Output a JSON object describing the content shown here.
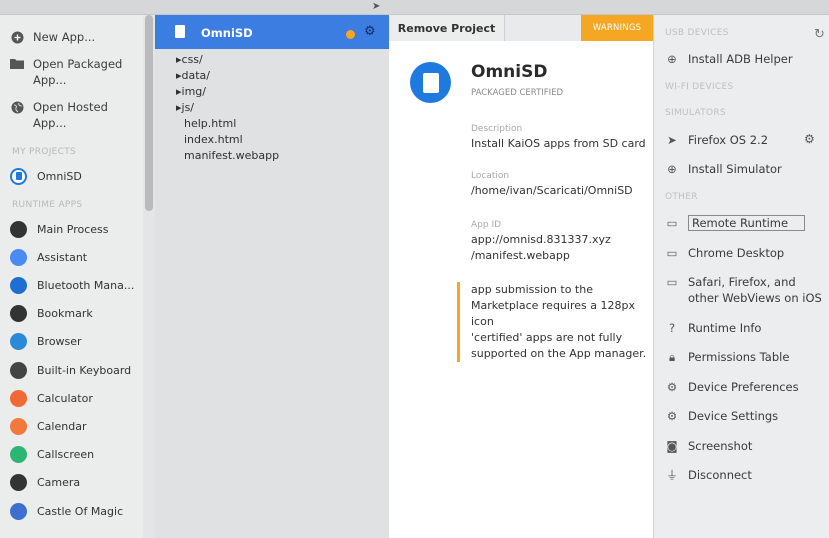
{
  "sidebar": {
    "new_app": "New App...",
    "open_packaged": "Open Packaged App...",
    "open_hosted": "Open Hosted App...",
    "my_projects_header": "MY PROJECTS",
    "project": "OmniSD",
    "runtime_apps_header": "RUNTIME APPS",
    "apps": [
      {
        "label": "Main Process",
        "color": "#333333"
      },
      {
        "label": "Assistant",
        "color": "#4a8af4"
      },
      {
        "label": "Bluetooth Mana...",
        "color": "#1f6fd1"
      },
      {
        "label": "Bookmark",
        "color": "#333333"
      },
      {
        "label": "Browser",
        "color": "#2a8ad8"
      },
      {
        "label": "Built-in Keyboard",
        "color": "#444444"
      },
      {
        "label": "Calculator",
        "color": "#f06a35"
      },
      {
        "label": "Calendar",
        "color": "#f2793d"
      },
      {
        "label": "Callscreen",
        "color": "#2bb673"
      },
      {
        "label": "Camera",
        "color": "#333333"
      },
      {
        "label": "Castle Of Magic",
        "color": "#3c6fd0"
      }
    ]
  },
  "files": {
    "project": "OmniSD",
    "tree": [
      "▸css/",
      "▸data/",
      "▸img/",
      "▸js/",
      "help.html",
      "index.html",
      "manifest.webapp"
    ]
  },
  "details": {
    "remove_label": "Remove Project",
    "warnings_label": "WARNINGS",
    "title": "OmniSD",
    "subtitle": "PACKAGED CERTIFIED",
    "description_label": "Description",
    "description": "Install KaiOS apps from SD card",
    "location_label": "Location",
    "location": "/home/ivan/Scaricati/OmniSD",
    "appid_label": "App ID",
    "appid_line1": "app://omnisd.831337.xyz",
    "appid_line2": "/manifest.webapp",
    "warning_1": "app submission to the Marketplace requires a 128px icon",
    "warning_2": "'certified' apps are not fully supported on the App manager."
  },
  "runtime": {
    "usb_header": "USB DEVICES",
    "install_adb": "Install ADB Helper",
    "wifi_header": "WI-FI DEVICES",
    "simulators_header": "SIMULATORS",
    "firefox_os": "Firefox OS 2.2",
    "install_sim": "Install Simulator",
    "other_header": "OTHER",
    "remote_runtime": "Remote Runtime",
    "chrome_desktop": "Chrome Desktop",
    "safari": "Safari, Firefox, and other WebViews on iOS",
    "runtime_info": "Runtime Info",
    "permissions": "Permissions Table",
    "device_prefs": "Device Preferences",
    "device_settings": "Device Settings",
    "screenshot": "Screenshot",
    "disconnect": "Disconnect"
  },
  "colors": {
    "accent": "#3b7de0",
    "warning": "#f5a623"
  }
}
